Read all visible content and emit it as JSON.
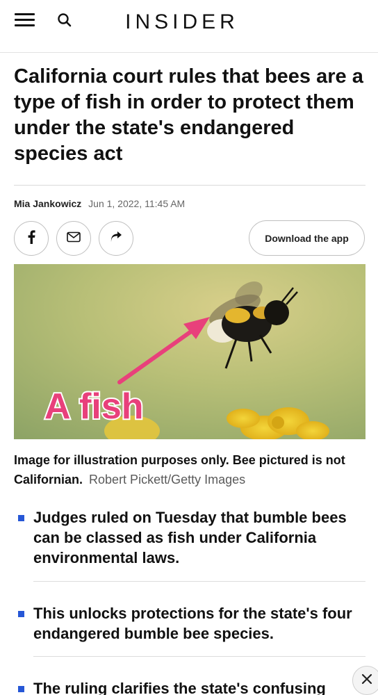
{
  "header": {
    "logo": "INSIDER",
    "menu_icon": "hamburger-icon",
    "search_icon": "search-icon"
  },
  "article": {
    "headline": "California court rules that bees are a type of fish in order to protect them under the state's endangered species act",
    "author": "Mia Jankowicz",
    "date": "Jun 1, 2022, 11:45 AM"
  },
  "share": {
    "facebook_icon": "facebook-icon",
    "email_icon": "mail-icon",
    "share_icon": "share-arrow-icon",
    "download_label": "Download the app"
  },
  "image": {
    "overlay_text": "A fish",
    "caption": "Image for illustration purposes only. Bee pictured is not Californian.",
    "credit": "Robert Pickett/Getty Images"
  },
  "bullets": [
    "Judges ruled on Tuesday that bumble bees can be classed as fish under California environmental laws.",
    "This unlocks protections for the state's four endangered bumble bee species.",
    "The ruling clarifies the state's confusing"
  ],
  "colors": {
    "bullet_accent": "#2657d6",
    "overlay_pink": "#e8407b"
  },
  "close_icon": "close-icon"
}
